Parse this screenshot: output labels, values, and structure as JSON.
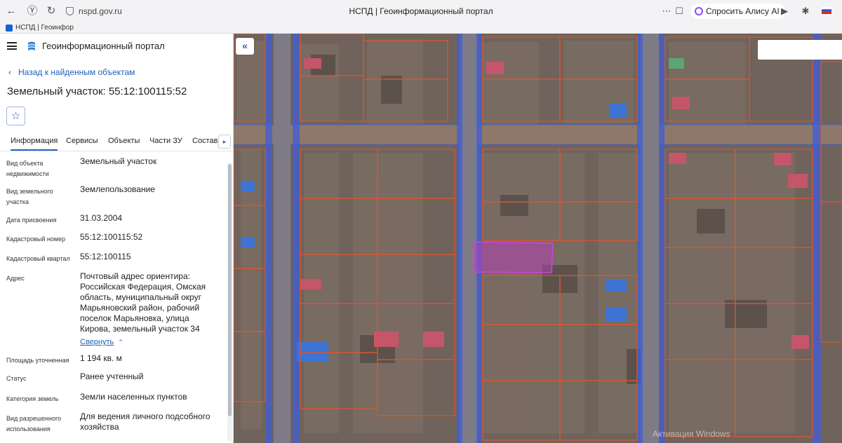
{
  "browser": {
    "url": "nspd.gov.ru",
    "tab_title": "НСПД | Геоинформационный портал",
    "alice_label": "Спросить Алису AI",
    "bookmark": "НСПД | Геоинфор"
  },
  "header": {
    "portal_title": "Геоинформационный портал"
  },
  "nav": {
    "back_label": "Назад к найденным объектам"
  },
  "object": {
    "title": "Земельный участок: 55:12:100115:52"
  },
  "tabs": [
    {
      "label": "Информация"
    },
    {
      "label": "Сервисы"
    },
    {
      "label": "Объекты"
    },
    {
      "label": "Части ЗУ"
    },
    {
      "label": "Состав"
    }
  ],
  "info": {
    "rows": [
      {
        "label": "Вид объекта недвижимости",
        "value": "Земельный участок"
      },
      {
        "label": "Вид земельного участка",
        "value": "Землепользование"
      },
      {
        "label": "Дата присвоения",
        "value": "31.03.2004"
      },
      {
        "label": "Кадастровый номер",
        "value": "55:12:100115:52"
      },
      {
        "label": "Кадастровый квартал",
        "value": "55:12:100115"
      },
      {
        "label": "Адрес",
        "value": "Почтовый адрес ориентира: Российская Федерация, Омская область, муниципальный округ Марьяновский район, рабочий поселок Марьяновка, улица Кирова, земельный участок 34"
      },
      {
        "label": "Площадь уточненная",
        "value": "1 194 кв. м"
      },
      {
        "label": "Статус",
        "value": "Ранее учтенный"
      },
      {
        "label": "Категория земель",
        "value": "Земли населенных пунктов"
      },
      {
        "label": "Вид разрешенного использования",
        "value": "Для ведения личного подсобного хозяйства"
      }
    ],
    "collapse_label": "Свернуть"
  },
  "map": {
    "watermark": "Активация Windows",
    "colors": {
      "ground": "#6e625a",
      "road": "#8f7a6c",
      "parcel_border": "#e0552e",
      "zone_overlay": "#3e5fd8",
      "selected_parcel": "#c23ac8"
    }
  }
}
